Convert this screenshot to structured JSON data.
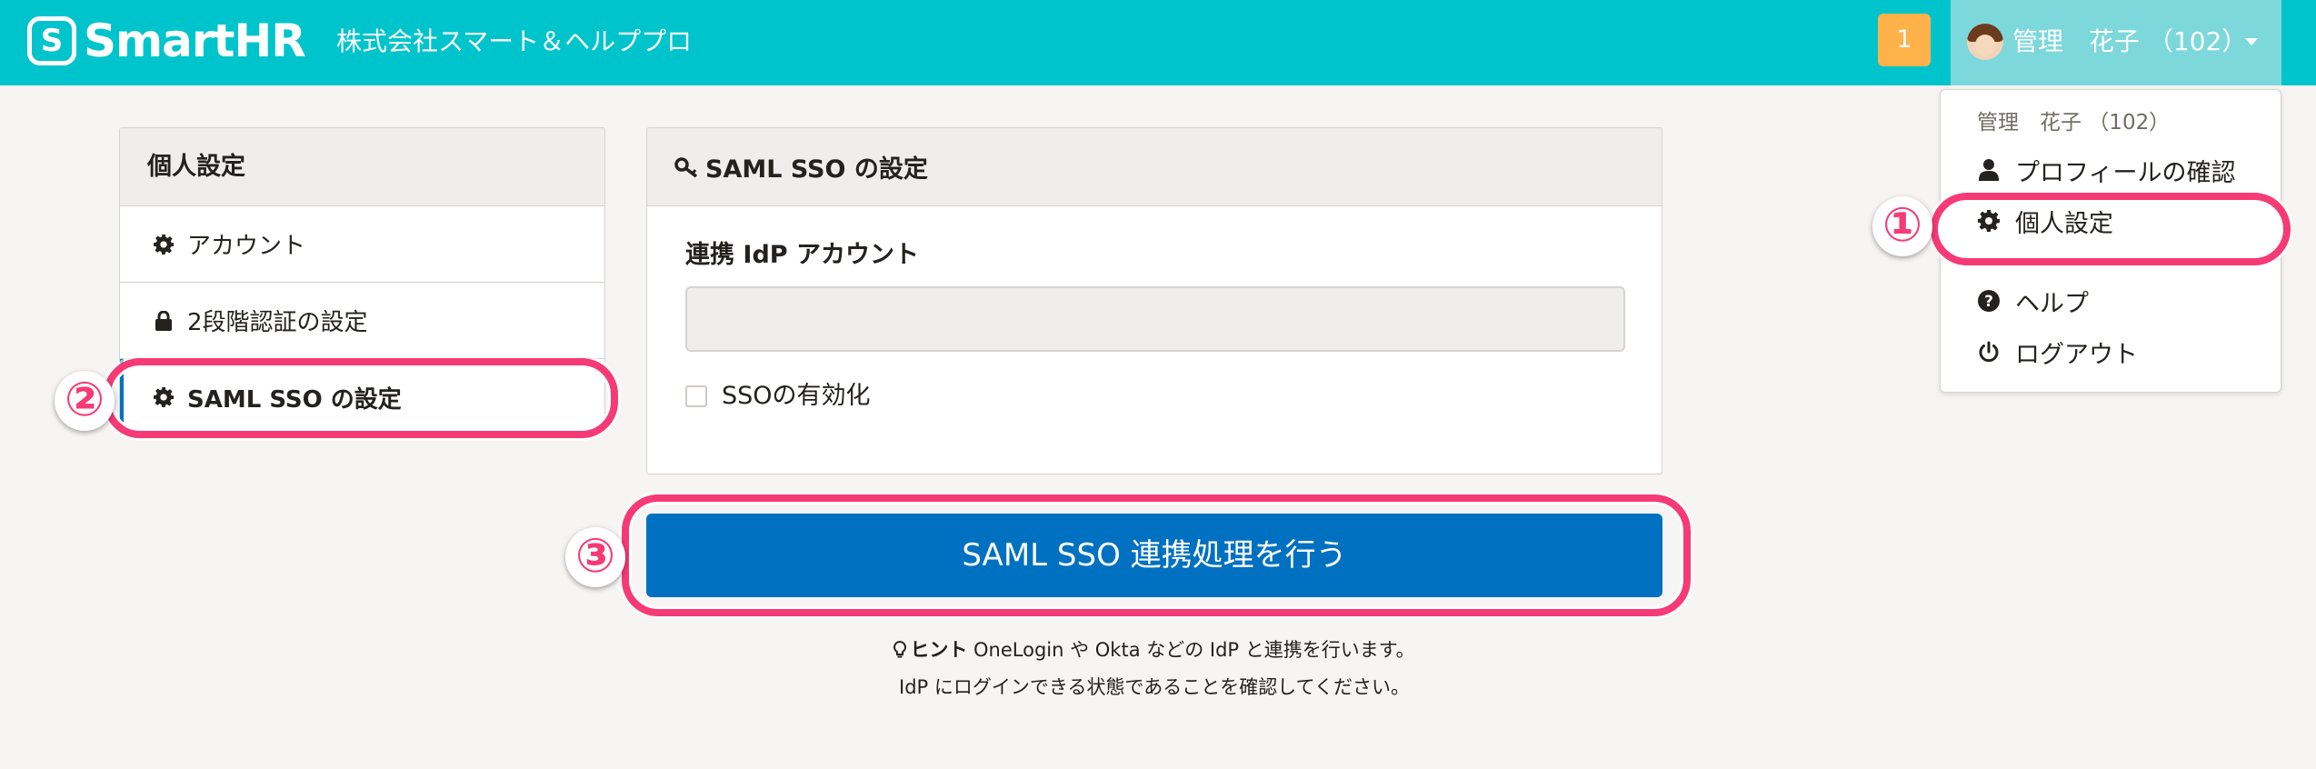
{
  "header": {
    "logo_mark": "S",
    "logo_text": "SmartHR",
    "company_name": "株式会社スマート＆ヘルププロ",
    "notification_count": "1",
    "user_name": "管理　花子 （102）"
  },
  "dropdown": {
    "header": "管理　花子 （102）",
    "items": [
      {
        "label": "プロフィールの確認",
        "icon": "user-icon"
      },
      {
        "label": "個人設定",
        "icon": "gear-icon"
      },
      {
        "label": "ヘルプ",
        "icon": "question-circle-icon"
      },
      {
        "label": "ログアウト",
        "icon": "power-icon"
      }
    ]
  },
  "sidebar": {
    "title": "個人設定",
    "items": [
      {
        "label": "アカウント",
        "icon": "gear-icon"
      },
      {
        "label": "2段階認証の設定",
        "icon": "lock-icon"
      },
      {
        "label": "SAML SSO の設定",
        "icon": "gear-icon",
        "active": true
      }
    ]
  },
  "panel": {
    "title": "SAML SSO の設定",
    "title_icon": "key-icon",
    "field_label": "連携 IdP アカウント",
    "field_value": "",
    "checkbox_label": "SSOの有効化",
    "checkbox_checked": false
  },
  "primary_button": "SAML SSO 連携処理を行う",
  "hint": {
    "icon": "lightbulb-icon",
    "bold": "ヒント",
    "line1": " OneLogin や Okta などの IdP と連携を行います。",
    "line2": "IdP にログインできる状態であることを確認してください。"
  },
  "annotations": [
    "①",
    "②",
    "③"
  ],
  "colors": {
    "header_bg": "#00c4cc",
    "user_menu_bg": "#7dd8dc",
    "badge_bg": "#ffb14a",
    "primary": "#0071c1",
    "highlight": "#f53a76"
  }
}
